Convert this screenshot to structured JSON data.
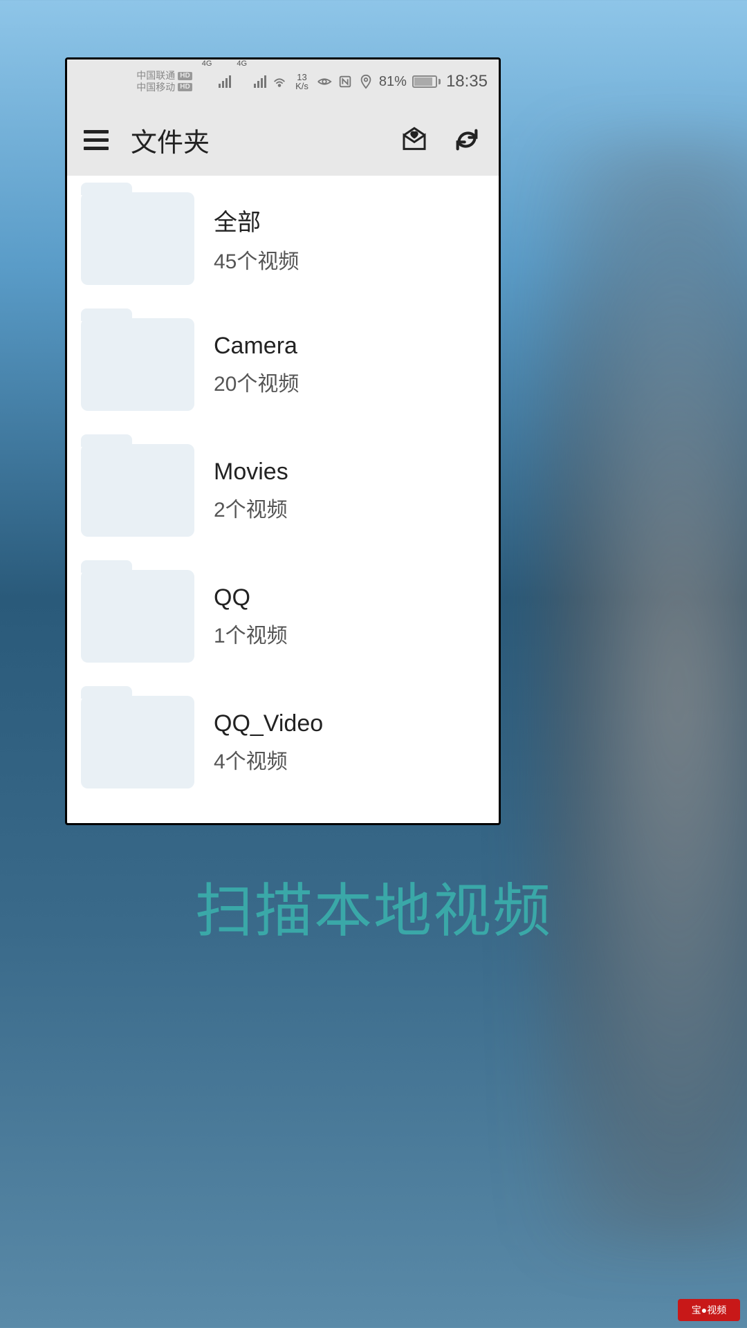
{
  "statusBar": {
    "carrier1": "中国联通",
    "carrier2": "中国移动",
    "hd": "HD",
    "netLabel": "4G",
    "speedValue": "13",
    "speedUnit": "K/s",
    "batteryPercent": "81%",
    "time": "18:35"
  },
  "header": {
    "title": "文件夹"
  },
  "folders": [
    {
      "name": "全部",
      "count": "45个视频"
    },
    {
      "name": "Camera",
      "count": "20个视频"
    },
    {
      "name": "Movies",
      "count": "2个视频"
    },
    {
      "name": "QQ",
      "count": "1个视频"
    },
    {
      "name": "QQ_Video",
      "count": "4个视频"
    }
  ],
  "caption": "扫描本地视频",
  "watermark": "宝●视频"
}
